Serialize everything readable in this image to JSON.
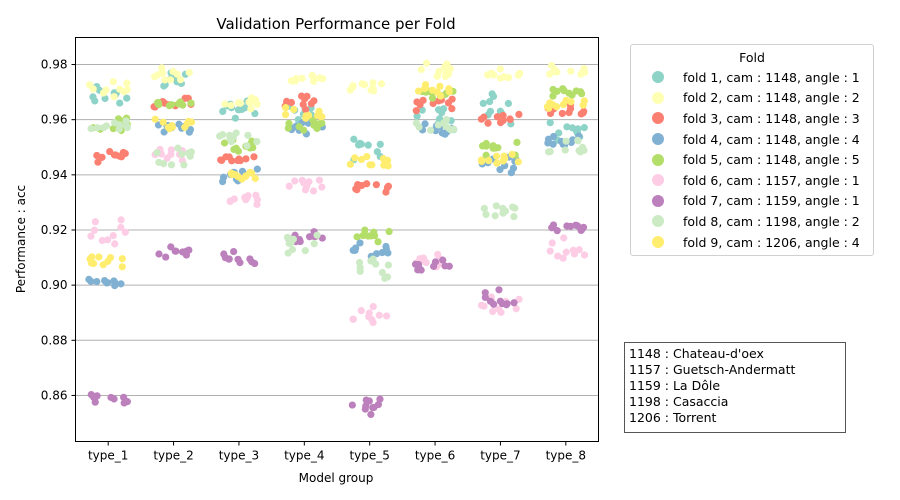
{
  "chart_data": {
    "type": "scatter",
    "subtype": "stripplot",
    "title": "Validation Performance per Fold",
    "xlabel": "Model group",
    "ylabel": "Performance : acc",
    "categories": [
      "type_1",
      "type_2",
      "type_3",
      "type_4",
      "type_5",
      "type_6",
      "type_7",
      "type_8"
    ],
    "ylim": [
      0.8433,
      0.9898
    ],
    "yticks": [
      0.86,
      0.88,
      0.9,
      0.92,
      0.94,
      0.96,
      0.98
    ],
    "ytick_labels": [
      "0.86",
      "0.88",
      "0.90",
      "0.92",
      "0.94",
      "0.96",
      "0.98"
    ],
    "grid": "y",
    "legend_title": "Fold",
    "legend_position": "outside-right-top",
    "points_per_cluster": 10,
    "series": [
      {
        "name": "fold 1, cam : 1148, angle : 1",
        "color": "#8dd3c7",
        "centers": [
          0.968,
          0.975,
          0.963,
          0.962,
          0.95,
          0.96,
          0.964,
          0.956
        ],
        "spread": [
          0.006,
          0.006,
          0.005,
          0.006,
          0.006,
          0.008,
          0.008,
          0.005
        ]
      },
      {
        "name": "fold 2, cam : 1148, angle : 2",
        "color": "#ffffb3",
        "centers": [
          0.971,
          0.977,
          0.966,
          0.975,
          0.972,
          0.978,
          0.976,
          0.977
        ],
        "spread": [
          0.004,
          0.004,
          0.003,
          0.003,
          0.003,
          0.004,
          0.003,
          0.004
        ]
      },
      {
        "name": "fold 3, cam : 1148, angle : 3",
        "color": "#fb8072",
        "centers": [
          0.947,
          0.966,
          0.946,
          0.967,
          0.936,
          0.966,
          0.96,
          0.963
        ],
        "spread": [
          0.003,
          0.004,
          0.004,
          0.004,
          0.003,
          0.004,
          0.003,
          0.004
        ]
      },
      {
        "name": "fold 4, cam : 1148, angle : 4",
        "color": "#80b1d3",
        "centers": [
          0.901,
          0.957,
          0.94,
          0.957,
          0.913,
          0.957,
          0.944,
          0.953
        ],
        "spread": [
          0.002,
          0.003,
          0.004,
          0.004,
          0.003,
          0.004,
          0.004,
          0.004
        ]
      },
      {
        "name": "fold 5, cam : 1148, angle : 5",
        "color": "#b3de69",
        "centers": [
          0.958,
          0.966,
          0.95,
          0.958,
          0.918,
          0.97,
          0.95,
          0.97
        ],
        "spread": [
          0.004,
          0.002,
          0.004,
          0.003,
          0.003,
          0.003,
          0.004,
          0.002
        ]
      },
      {
        "name": "fold 6, cam : 1157, angle : 1",
        "color": "#fccde5",
        "centers": [
          0.919,
          0.948,
          0.931,
          0.937,
          0.889,
          0.908,
          0.892,
          0.913
        ],
        "spread": [
          0.006,
          0.004,
          0.004,
          0.004,
          0.005,
          0.004,
          0.005,
          0.006
        ]
      },
      {
        "name": "fold 7, cam : 1159, angle : 1",
        "color": "#bc80bd",
        "centers": [
          0.859,
          0.912,
          0.91,
          0.917,
          0.856,
          0.907,
          0.894,
          0.921
        ],
        "spread": [
          0.004,
          0.004,
          0.003,
          0.004,
          0.004,
          0.003,
          0.005,
          0.003
        ]
      },
      {
        "name": "fold 8, cam : 1198, angle : 2",
        "color": "#ccebc5",
        "centers": [
          0.958,
          0.946,
          0.953,
          0.913,
          0.906,
          0.957,
          0.927,
          0.95
        ],
        "spread": [
          0.003,
          0.006,
          0.004,
          0.01,
          0.007,
          0.004,
          0.004,
          0.006
        ]
      },
      {
        "name": "fold 9, cam : 1206, angle : 4",
        "color": "#ffed6f",
        "centers": [
          0.908,
          0.958,
          0.94,
          0.962,
          0.944,
          0.97,
          0.946,
          0.966
        ],
        "spread": [
          0.003,
          0.004,
          0.004,
          0.004,
          0.004,
          0.004,
          0.004,
          0.004
        ]
      }
    ]
  },
  "site_legend": {
    "lines": [
      "1148 : Chateau-d'oex",
      "1157 : Guetsch-Andermatt",
      "1159 : La Dôle",
      "1198 : Casaccia",
      "1206 : Torrent"
    ]
  }
}
